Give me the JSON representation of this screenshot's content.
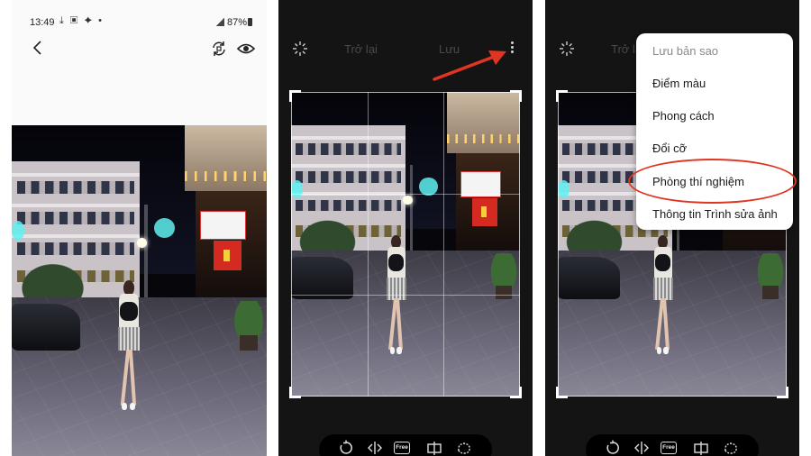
{
  "statusbar": {
    "time": "13:49",
    "icons": "⤓ ▣ ✦ •",
    "battery": "87%"
  },
  "editor": {
    "revert_label": "Trở lại",
    "save_label": "Lưu",
    "toolbar": {
      "free_label": "Free"
    }
  },
  "menu": {
    "items": [
      {
        "label": "Lưu bản sao",
        "enabled": false
      },
      {
        "label": "Điểm màu",
        "enabled": true
      },
      {
        "label": "Phong cách",
        "enabled": true
      },
      {
        "label": "Đổi cỡ",
        "enabled": true
      },
      {
        "label": "Phòng thí nghiệm",
        "enabled": true,
        "highlighted": true
      },
      {
        "label": "Thông tin Trình sửa ảnh",
        "enabled": true
      }
    ]
  },
  "icons": {
    "viewer": [
      "back-icon",
      "rotate-screen-icon",
      "eye-icon"
    ],
    "editor_top": [
      "auto-enhance-sparkle-icon",
      "more-options-icon"
    ],
    "editor_tools": [
      "rotate-icon",
      "flip-icon",
      "free-crop-icon",
      "aspect-icon",
      "lasso-icon"
    ]
  },
  "colors": {
    "annotation_red": "#e03522",
    "editor_bg": "#141414",
    "viewer_bg": "#fafafa"
  }
}
